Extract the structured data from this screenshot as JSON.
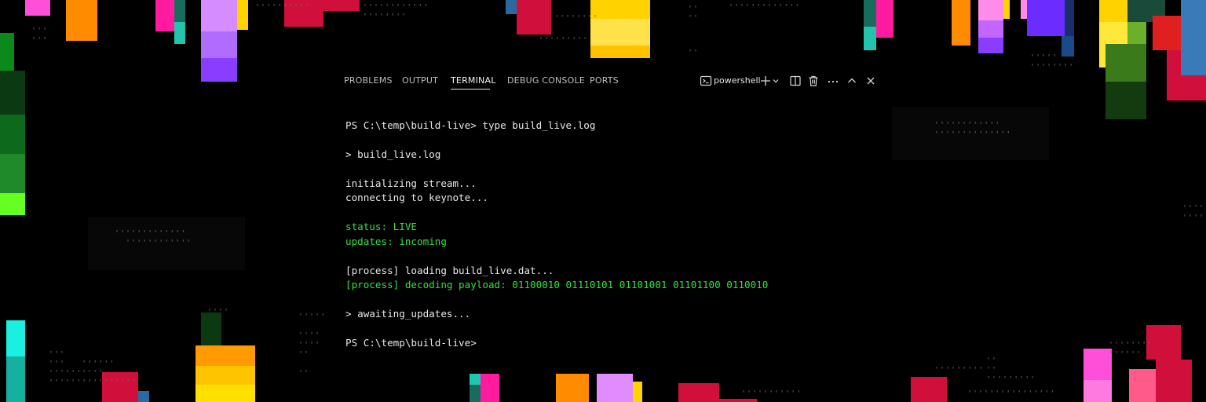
{
  "panel": {
    "tabs": [
      {
        "label": "PROBLEMS",
        "active": false
      },
      {
        "label": "OUTPUT",
        "active": false
      },
      {
        "label": "TERMINAL",
        "active": true
      },
      {
        "label": "DEBUG CONSOLE",
        "active": false
      },
      {
        "label": "PORTS",
        "active": false
      }
    ],
    "shell_name": "powershell",
    "actions": [
      "terminal-icon",
      "plus-icon",
      "chevron-down-icon",
      "split-icon",
      "trash-icon",
      "more-icon",
      "chevron-up-icon",
      "close-icon"
    ]
  },
  "terminal": {
    "lines": [
      {
        "text": "PS C:\\temp\\build-live> type build_live.log",
        "color": "#e8e8e8"
      },
      {
        "text": "> build_live.log",
        "color": "#e8e8e8"
      },
      {
        "text": "initializing stream...",
        "color": "#e8e8e8"
      },
      {
        "text": "connecting to keynote...",
        "color": "#e8e8e8"
      },
      {
        "text": "status: LIVE",
        "color": "#35e040"
      },
      {
        "text": "updates: incoming",
        "color": "#35e040"
      },
      {
        "text": "[process] loading build_live.dat...",
        "color": "#e8e8e8"
      },
      {
        "text": "[process] decoding payload: 01100010 01110101 01101001 01101100 0110010",
        "color": "#35e040"
      },
      {
        "text": "> awaiting_updates...",
        "color": "#e8e8e8"
      },
      {
        "text": "PS C:\\temp\\build-live>",
        "color": "#e8e8e8"
      }
    ]
  },
  "colors": {
    "background": "#000000",
    "tab_text": "#bdbdbd",
    "tab_active": "#f2f2f2",
    "terminal_text": "#e8e8e8",
    "terminal_green": "#35e040",
    "pixel_palette": [
      "#ff8c00",
      "#ffd200",
      "#ff2aa8",
      "#a259ff",
      "#7a2cff",
      "#1fc7b0",
      "#d0103a",
      "#20a020",
      "#7bff2a"
    ]
  }
}
